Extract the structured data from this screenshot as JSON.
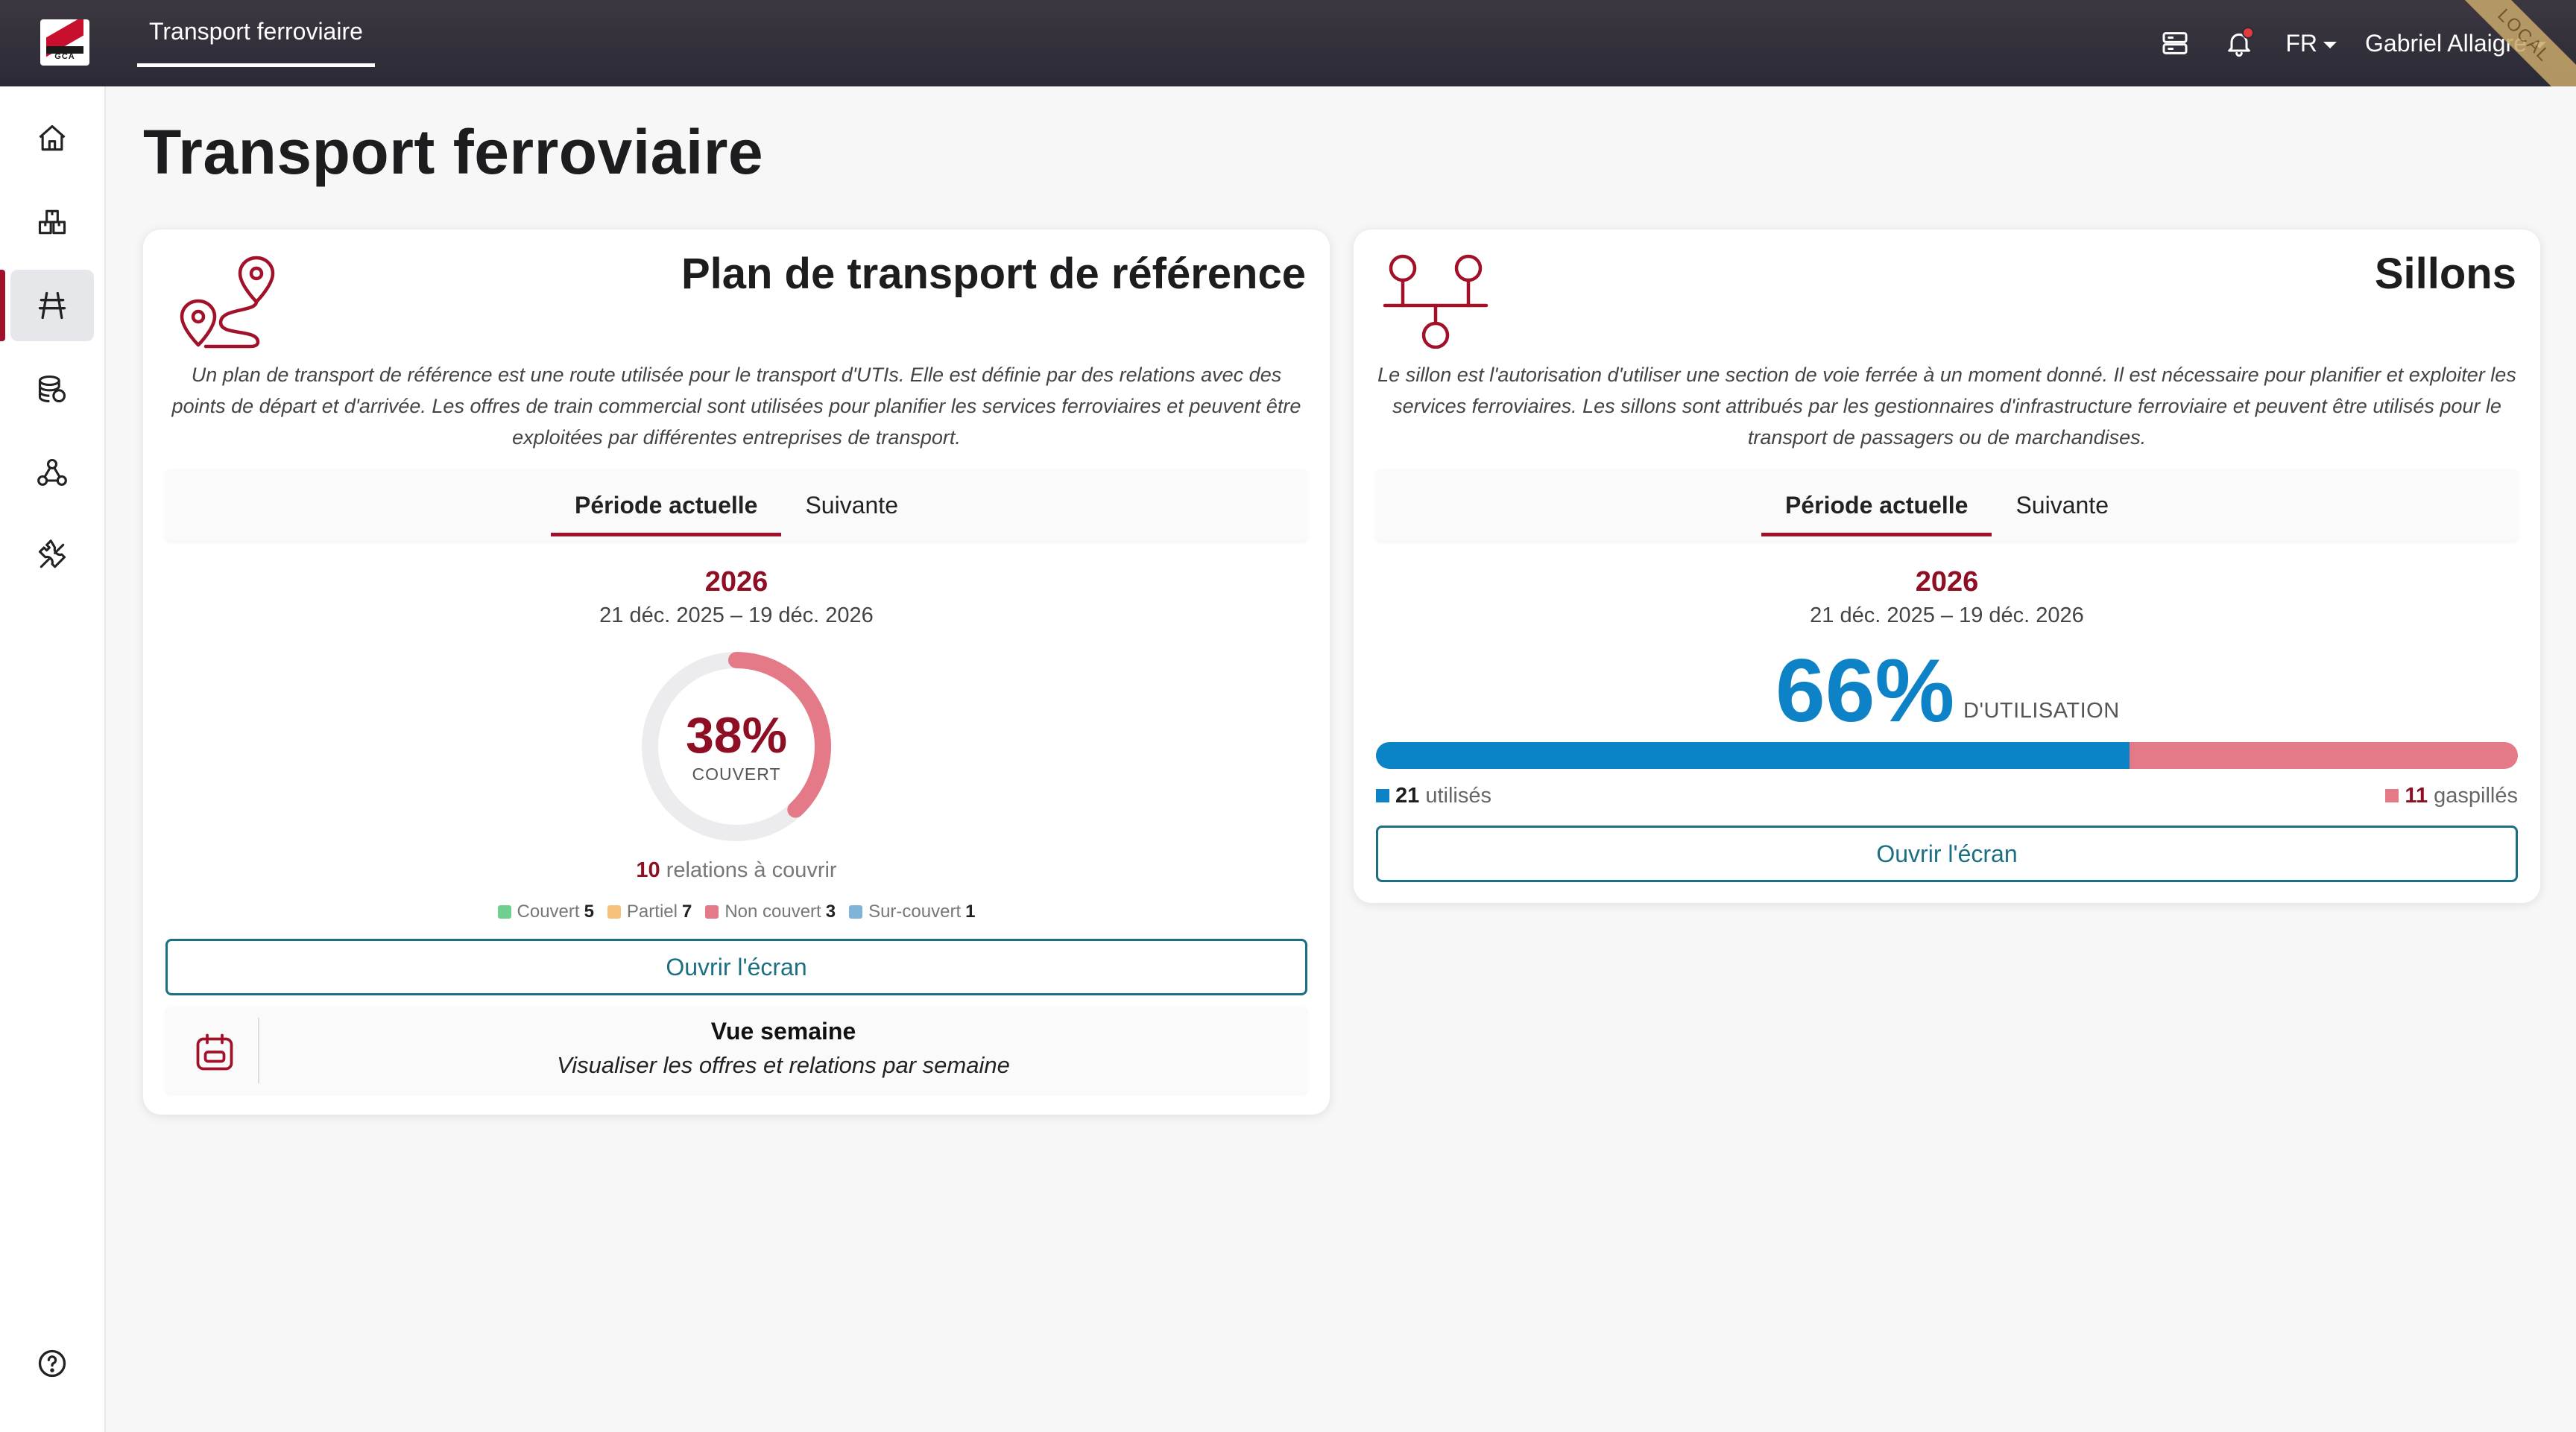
{
  "topbar": {
    "logo_text": "GCA",
    "tab_label": "Transport ferroviaire",
    "language": "FR",
    "user_name": "Gabriel Allaigre",
    "ribbon": "LOCAL"
  },
  "page": {
    "title": "Transport ferroviaire"
  },
  "card_plan": {
    "title": "Plan de transport de référence",
    "description": "Un plan de transport de référence est une route utilisée pour le transport d'UTIs. Elle est définie par des relations avec des points de départ et d'arrivée. Les offres de train commercial sont utilisées pour planifier les services ferroviaires et peuvent être exploitées par différentes entreprises de transport.",
    "tabs": [
      "Période actuelle",
      "Suivante"
    ],
    "year": "2026",
    "date_range": "21 déc. 2025 – 19 déc. 2026",
    "coverage_percent_text": "38%",
    "coverage_fraction": 0.38,
    "coverage_label": "COUVERT",
    "relations_count": "10",
    "relations_text": "relations à couvrir",
    "legend": [
      {
        "label": "Couvert",
        "value": "5",
        "color": "#6fcf8f"
      },
      {
        "label": "Partiel",
        "value": "7",
        "color": "#f7c07a"
      },
      {
        "label": "Non couvert",
        "value": "3",
        "color": "#e47a88"
      },
      {
        "label": "Sur-couvert",
        "value": "1",
        "color": "#7fb3d8"
      }
    ],
    "open_button": "Ouvrir l'écran",
    "week_view": {
      "title": "Vue semaine",
      "subtitle": "Visualiser les offres et relations par semaine"
    }
  },
  "card_sillons": {
    "title": "Sillons",
    "description": "Le sillon est l'autorisation d'utiliser une section de voie ferrée à un moment donné. Il est nécessaire pour planifier et exploiter les services ferroviaires. Les sillons sont attribués par les gestionnaires d'infrastructure ferroviaire et peuvent être utilisés pour le transport de passagers ou de marchandises.",
    "tabs": [
      "Période actuelle",
      "Suivante"
    ],
    "year": "2026",
    "date_range": "21 déc. 2025 – 19 déc. 2026",
    "utilisation_percent_text": "66%",
    "utilisation_fraction": 0.66,
    "utilisation_label": "D'UTILISATION",
    "used_count": "21",
    "used_label": "utilisés",
    "wasted_count": "11",
    "wasted_label": "gaspillés",
    "open_button": "Ouvrir l'écran"
  },
  "colors": {
    "brand_red": "#a1122a",
    "accent_blue": "#0a84c6",
    "waste_pink": "#e47a88",
    "button_teal": "#1c6f82"
  }
}
